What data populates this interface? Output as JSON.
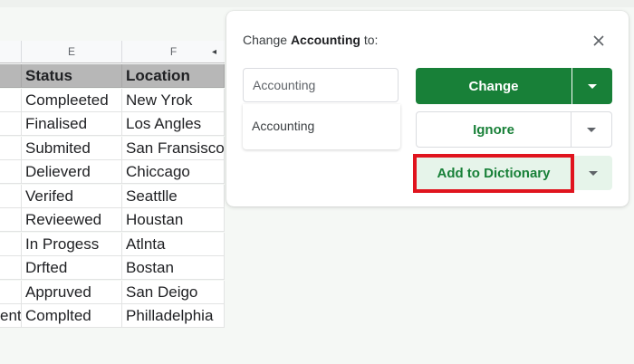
{
  "sheet": {
    "columns": [
      {
        "letter": "E"
      },
      {
        "letter": "F"
      }
    ],
    "header": {
      "lead": "",
      "status": "Status",
      "location": "Location"
    },
    "rows": [
      {
        "lead": "",
        "status": "Compleeted",
        "location": "New Yrok"
      },
      {
        "lead": "",
        "status": "Finalised",
        "location": "Los Angles"
      },
      {
        "lead": "",
        "status": "Submited",
        "location": "San Fransisco"
      },
      {
        "lead": "",
        "status": "Delieverd",
        "location": "Chiccago"
      },
      {
        "lead": "",
        "status": "Verifed",
        "location": "Seattlle"
      },
      {
        "lead": "",
        "status": "Revieewed",
        "location": "Houstan"
      },
      {
        "lead": "",
        "status": "In Progess",
        "location": "Atlnta"
      },
      {
        "lead": "",
        "status": "Drfted",
        "location": "Bostan"
      },
      {
        "lead": "",
        "status": "Appruved",
        "location": "San Deigo"
      },
      {
        "lead": "ent",
        "status": "Complted",
        "location": "Philladelphia"
      }
    ]
  },
  "dialog": {
    "title_prefix": "Change ",
    "word": "Accounting",
    "title_suffix": " to:",
    "suggestion_value": "Accounting",
    "suggestions": [
      "Accounting"
    ],
    "change_label": "Change",
    "ignore_label": "Ignore",
    "add_dictionary_label": "Add to Dictionary"
  },
  "colors": {
    "primary_green": "#188038",
    "light_green": "#e6f4ea",
    "highlight_red": "#e0141e",
    "header_grey": "#b7b7b7"
  }
}
